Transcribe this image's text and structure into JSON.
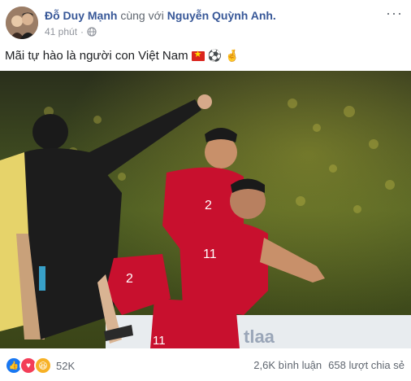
{
  "post": {
    "author": "Đỗ Duy Mạnh",
    "with_text": "cùng với",
    "tagged": "Nguyễn Quỳnh Anh.",
    "time": "41 phút",
    "dot": "·",
    "more": "···",
    "text": "Mãi tự hào là người con Việt Nam",
    "emoji_ball": "⚽",
    "emoji_hand": "🤞"
  },
  "photo": {
    "players": [
      {
        "number": "2"
      },
      {
        "number": "11"
      },
      {
        "number": "2"
      },
      {
        "number": "11"
      }
    ]
  },
  "footer": {
    "reaction_count": "52K",
    "comments": "2,6K bình luận",
    "shares": "658 lượt chia sẻ"
  },
  "colors": {
    "link": "#385898",
    "like": "#1877f2",
    "love": "#f33e58",
    "haha": "#f7b125",
    "jersey": "#c8102e"
  }
}
